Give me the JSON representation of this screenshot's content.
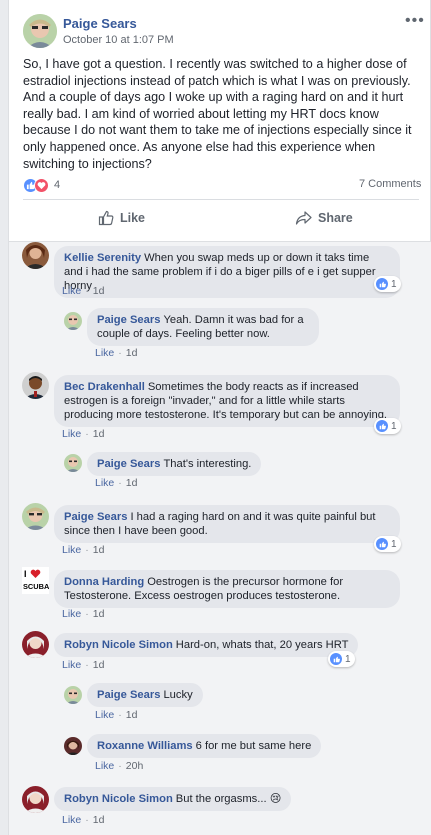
{
  "post": {
    "author": "Paige Sears",
    "timestamp": "October 10 at 1:07 PM",
    "text": "So, I have got a question. I recently was switched to a higher dose of estradiol injections instead of patch which is what I was on previously. And a couple of days ago I woke up with a raging hard on and it hurt really bad. I am kind of worried about letting my HRT docs know because I do not want them to take me of injections especially since it only happened once. As anyone else had this experience when switching to injections?",
    "reaction_count": "4",
    "comment_count": "7 Comments",
    "like_label": "Like",
    "share_label": "Share"
  },
  "comment_actions": {
    "like": "Like",
    "separator": "·"
  },
  "comments": [
    {
      "name": "Kellie Serenity",
      "text": "When you swap meds up or down it taks time and i had the same problem if i do a biger pills of e i get supper horny",
      "time": "1d",
      "reactions": "1"
    },
    {
      "name": "Paige Sears",
      "text": "Yeah. Damn it was bad for a couple of days. Feeling better now.",
      "time": "1d"
    },
    {
      "name": "Bec Drakenhall",
      "text": "Sometimes the body reacts as if increased estrogen is a foreign \"invader,\" and for a little while starts producing more testosterone. It's temporary but can be annoying.",
      "time": "1d",
      "reactions": "1"
    },
    {
      "name": "Paige Sears",
      "text": "That's interesting.",
      "time": "1d"
    },
    {
      "name": "Paige Sears",
      "text": "I had a raging hard on and it was quite painful but since then I have been good.",
      "time": "1d",
      "reactions": "1"
    },
    {
      "name": "Donna Harding",
      "text": "Oestrogen is the precursor hormone for Testosterone. Excess oestrogen produces testosterone.",
      "time": "1d"
    },
    {
      "name": "Robyn Nicole Simon",
      "text": "Hard-on, whats that, 20 years HRT",
      "time": "1d",
      "reactions": "1"
    },
    {
      "name": "Paige Sears",
      "text": "Lucky",
      "time": "1d"
    },
    {
      "name": "Roxanne Williams",
      "text": "6 for me but same here",
      "time": "20h"
    },
    {
      "name": "Robyn Nicole Simon",
      "text": "But the orgasms...",
      "time": "1d",
      "emoji": "😢"
    }
  ],
  "avatars": {
    "donna_logo_text": "SCUBA"
  },
  "colors": {
    "link_blue": "#365899",
    "like_blue": "#5890ff",
    "love_red": "#f25268",
    "bubble_bg": "#e4e6eb",
    "page_bg": "#e9ebee"
  }
}
